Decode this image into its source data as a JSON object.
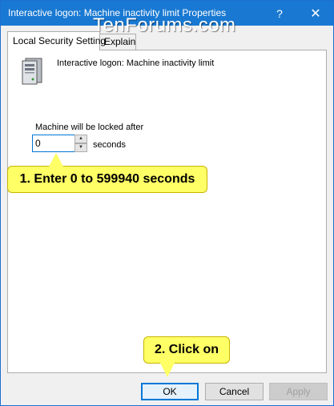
{
  "window": {
    "title": "Interactive logon: Machine inactivity limit Properties",
    "help_glyph": "?",
    "close_glyph": "✕",
    "watermark": "TenForums.com"
  },
  "tabs": [
    {
      "label": "Local Security Setting",
      "active": true
    },
    {
      "label": "Explain",
      "active": false
    }
  ],
  "policy": {
    "icon": "server-icon",
    "name": "Interactive logon: Machine inactivity limit"
  },
  "setting": {
    "label": "Machine will be locked after",
    "value": "0",
    "unit": "seconds",
    "up_glyph": "▲",
    "down_glyph": "▼"
  },
  "callouts": {
    "step1": "1. Enter 0 to 599940 seconds",
    "step2": "2. Click on"
  },
  "buttons": {
    "ok": "OK",
    "cancel": "Cancel",
    "apply": "Apply"
  },
  "colors": {
    "titlebar": "#1979d2",
    "callout": "#ffff66",
    "accent": "#0078d7"
  }
}
